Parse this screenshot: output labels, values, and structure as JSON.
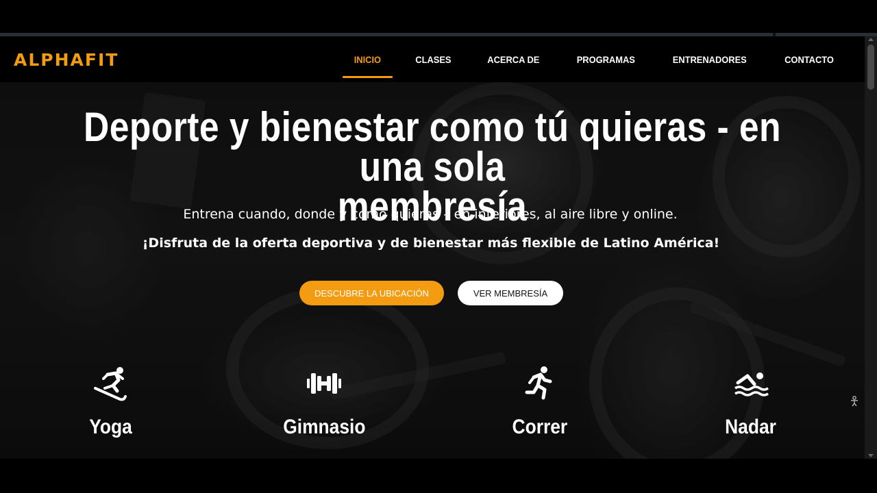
{
  "brand": {
    "logo": "ALPHAFIT",
    "accent_color": "#f39c12"
  },
  "nav": {
    "items": [
      {
        "label": "INICIO",
        "active": true
      },
      {
        "label": "CLASES",
        "active": false
      },
      {
        "label": "ACERCA DE",
        "active": false
      },
      {
        "label": "PROGRAMAS",
        "active": false
      },
      {
        "label": "ENTRENADORES",
        "active": false
      },
      {
        "label": "CONTACTO",
        "active": false
      }
    ]
  },
  "hero": {
    "headline_line1": "Deporte y bienestar como tú quieras - en una sola",
    "headline_line2": "membresía",
    "subtitle": "Entrena cuando, donde y como quieras –  en interiores, al aire libre y online.",
    "tagline": "¡Disfruta de la oferta deportiva y de bienestar más flexible de Latino América!",
    "primary_button": "DESCUBRE LA UBICACIÓN",
    "secondary_button": "VER MEMBRESÍA"
  },
  "features": [
    {
      "label": "Yoga",
      "icon": "skiing-icon"
    },
    {
      "label": "Gimnasio",
      "icon": "dumbbell-icon"
    },
    {
      "label": "Correr",
      "icon": "running-icon"
    },
    {
      "label": "Nadar",
      "icon": "swimming-icon"
    }
  ]
}
